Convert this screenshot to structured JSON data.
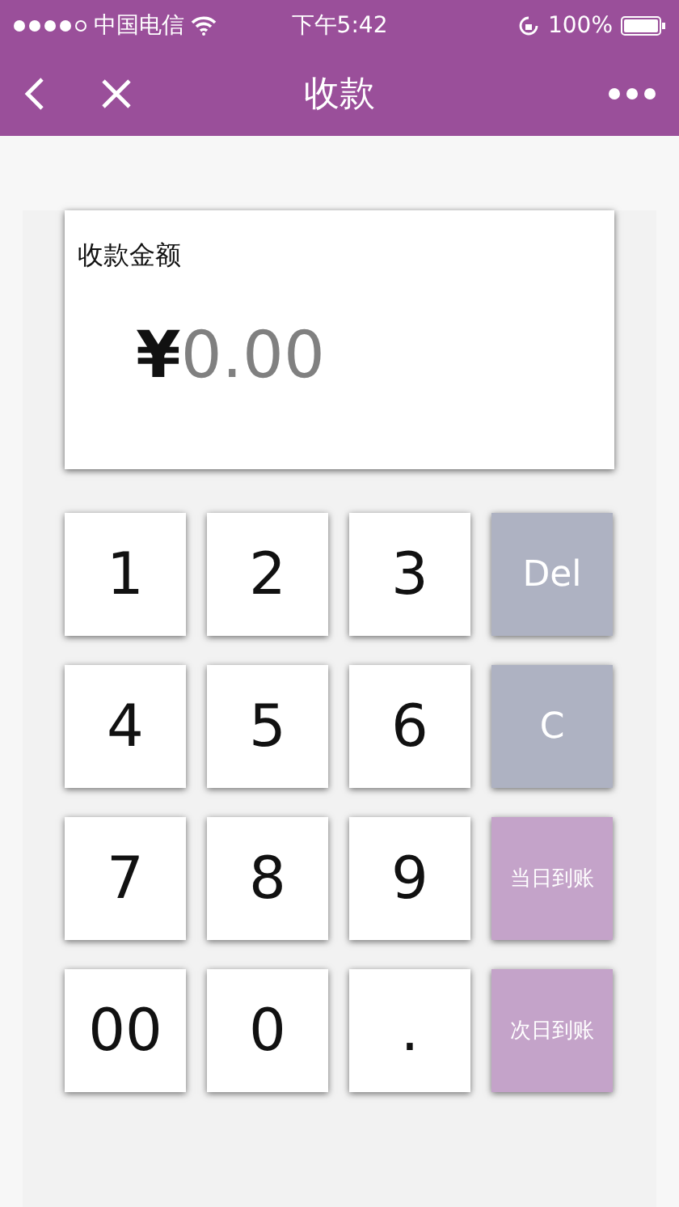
{
  "status_bar": {
    "carrier": "中国电信",
    "time": "下午5:42",
    "battery": "100%"
  },
  "nav": {
    "title": "收款"
  },
  "amount_card": {
    "label": "收款金额",
    "currency": "¥",
    "amount": "0.00"
  },
  "keys": [
    {
      "label": "1",
      "kind": "digit"
    },
    {
      "label": "2",
      "kind": "digit"
    },
    {
      "label": "3",
      "kind": "digit"
    },
    {
      "label": "Del",
      "kind": "action"
    },
    {
      "label": "4",
      "kind": "digit"
    },
    {
      "label": "5",
      "kind": "digit"
    },
    {
      "label": "6",
      "kind": "digit"
    },
    {
      "label": "C",
      "kind": "action"
    },
    {
      "label": "7",
      "kind": "digit"
    },
    {
      "label": "8",
      "kind": "digit"
    },
    {
      "label": "9",
      "kind": "digit"
    },
    {
      "label": "当日到账",
      "kind": "settle"
    },
    {
      "label": "00",
      "kind": "digit"
    },
    {
      "label": "0",
      "kind": "digit"
    },
    {
      "label": ".",
      "kind": "digit"
    },
    {
      "label": "次日到账",
      "kind": "settle"
    }
  ]
}
